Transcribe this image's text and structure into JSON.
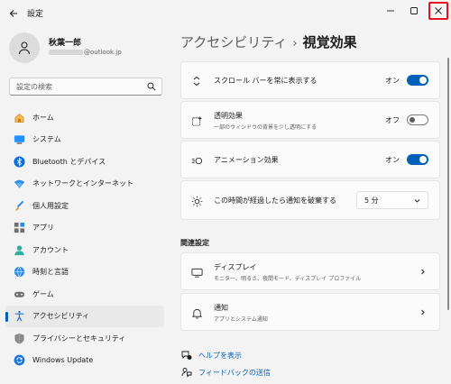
{
  "window": {
    "title": "設定"
  },
  "profile": {
    "name": "秋葉一郎",
    "email_suffix": "@outlook.jp"
  },
  "search": {
    "placeholder": "設定の検索"
  },
  "nav": {
    "items": [
      {
        "label": "ホーム",
        "icon": "home-icon"
      },
      {
        "label": "システム",
        "icon": "system-icon"
      },
      {
        "label": "Bluetooth とデバイス",
        "icon": "bluetooth-icon"
      },
      {
        "label": "ネットワークとインターネット",
        "icon": "network-icon"
      },
      {
        "label": "個人用設定",
        "icon": "personalization-icon"
      },
      {
        "label": "アプリ",
        "icon": "apps-icon"
      },
      {
        "label": "アカウント",
        "icon": "account-icon"
      },
      {
        "label": "時刻と言語",
        "icon": "time-language-icon"
      },
      {
        "label": "ゲーム",
        "icon": "gaming-icon"
      },
      {
        "label": "アクセシビリティ",
        "icon": "accessibility-icon",
        "active": true
      },
      {
        "label": "プライバシーとセキュリティ",
        "icon": "privacy-icon"
      },
      {
        "label": "Windows Update",
        "icon": "windows-update-icon"
      }
    ]
  },
  "header": {
    "breadcrumb": "アクセシビリティ",
    "separator": "›",
    "current": "視覚効果"
  },
  "settings": {
    "scrollbars": {
      "label": "スクロール バーを常に表示する",
      "state": "オン",
      "on": true
    },
    "transparency": {
      "label": "透明効果",
      "sublabel": "一部のウィンドウの背景を少し透明にする",
      "state": "オフ",
      "on": false
    },
    "animation": {
      "label": "アニメーション効果",
      "state": "オン",
      "on": true
    },
    "notification": {
      "label": "この時間が経過したら通知を破棄する",
      "value": "5 分"
    }
  },
  "related": {
    "heading": "関連設定",
    "display": {
      "label": "ディスプレイ",
      "sublabel": "モニター、明るさ、夜間モード、ディスプレイ プロファイル"
    },
    "notifications": {
      "label": "通知",
      "sublabel": "アプリとシステム通知"
    }
  },
  "help": {
    "get_help": "ヘルプを表示",
    "feedback": "フィードバックの送信"
  },
  "colors": {
    "accent": "#005fb8",
    "close_highlight": "#e81123",
    "background": "#f3f3f3"
  }
}
